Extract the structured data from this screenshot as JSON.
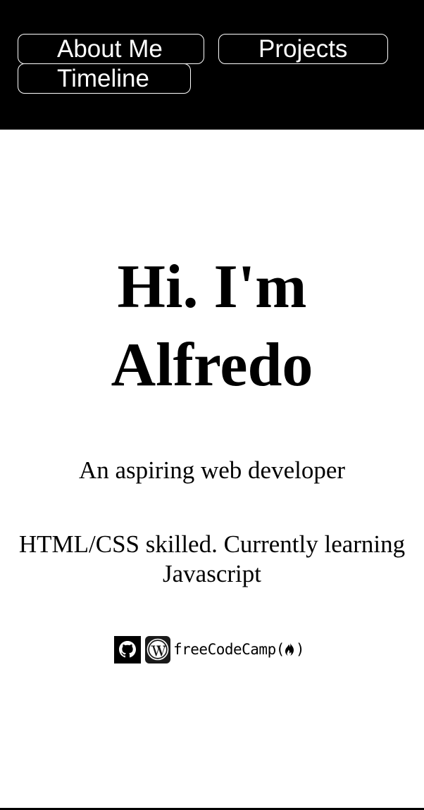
{
  "nav": {
    "about": "About Me",
    "projects": "Projects",
    "timeline": "Timeline"
  },
  "hero": {
    "title_line1": "Hi. I'm",
    "title_line2": "Alfredo",
    "tagline": "An aspiring web developer",
    "skills_line1": "HTML/CSS skilled. Currently learning",
    "skills_line2": "Javascript"
  },
  "links": {
    "github_icon": "github-icon",
    "wordpress_icon": "wordpress-icon",
    "fcc_text_prefix": "freeCodeCamp(",
    "fcc_text_suffix": ")",
    "fcc_icon": "flame-icon"
  },
  "colors": {
    "navbar_bg": "#000000",
    "nav_text": "#ffffff",
    "page_bg": "#ffffff",
    "text": "#000000"
  }
}
